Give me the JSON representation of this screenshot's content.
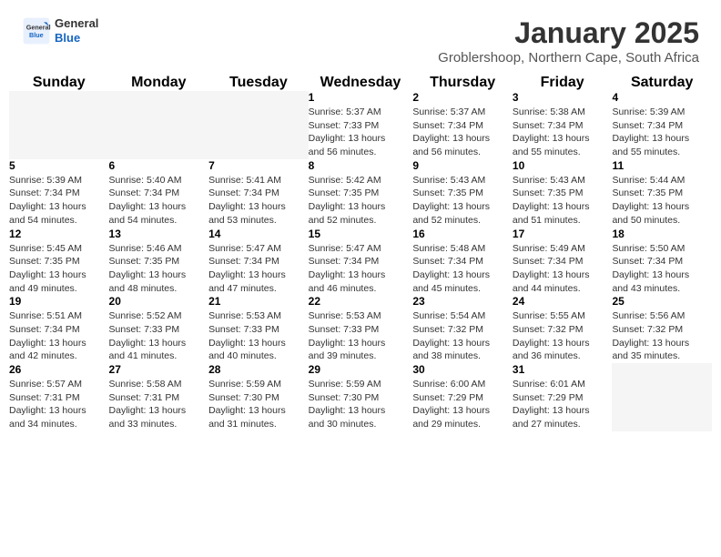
{
  "header": {
    "logo": {
      "general": "General",
      "blue": "Blue"
    },
    "title": "January 2025",
    "location": "Groblershoop, Northern Cape, South Africa"
  },
  "calendar": {
    "weekdays": [
      "Sunday",
      "Monday",
      "Tuesday",
      "Wednesday",
      "Thursday",
      "Friday",
      "Saturday"
    ],
    "weeks": [
      [
        {
          "day": "",
          "info": ""
        },
        {
          "day": "",
          "info": ""
        },
        {
          "day": "",
          "info": ""
        },
        {
          "day": "1",
          "info": "Sunrise: 5:37 AM\nSunset: 7:33 PM\nDaylight: 13 hours\nand 56 minutes."
        },
        {
          "day": "2",
          "info": "Sunrise: 5:37 AM\nSunset: 7:34 PM\nDaylight: 13 hours\nand 56 minutes."
        },
        {
          "day": "3",
          "info": "Sunrise: 5:38 AM\nSunset: 7:34 PM\nDaylight: 13 hours\nand 55 minutes."
        },
        {
          "day": "4",
          "info": "Sunrise: 5:39 AM\nSunset: 7:34 PM\nDaylight: 13 hours\nand 55 minutes."
        }
      ],
      [
        {
          "day": "5",
          "info": "Sunrise: 5:39 AM\nSunset: 7:34 PM\nDaylight: 13 hours\nand 54 minutes."
        },
        {
          "day": "6",
          "info": "Sunrise: 5:40 AM\nSunset: 7:34 PM\nDaylight: 13 hours\nand 54 minutes."
        },
        {
          "day": "7",
          "info": "Sunrise: 5:41 AM\nSunset: 7:34 PM\nDaylight: 13 hours\nand 53 minutes."
        },
        {
          "day": "8",
          "info": "Sunrise: 5:42 AM\nSunset: 7:35 PM\nDaylight: 13 hours\nand 52 minutes."
        },
        {
          "day": "9",
          "info": "Sunrise: 5:43 AM\nSunset: 7:35 PM\nDaylight: 13 hours\nand 52 minutes."
        },
        {
          "day": "10",
          "info": "Sunrise: 5:43 AM\nSunset: 7:35 PM\nDaylight: 13 hours\nand 51 minutes."
        },
        {
          "day": "11",
          "info": "Sunrise: 5:44 AM\nSunset: 7:35 PM\nDaylight: 13 hours\nand 50 minutes."
        }
      ],
      [
        {
          "day": "12",
          "info": "Sunrise: 5:45 AM\nSunset: 7:35 PM\nDaylight: 13 hours\nand 49 minutes."
        },
        {
          "day": "13",
          "info": "Sunrise: 5:46 AM\nSunset: 7:35 PM\nDaylight: 13 hours\nand 48 minutes."
        },
        {
          "day": "14",
          "info": "Sunrise: 5:47 AM\nSunset: 7:34 PM\nDaylight: 13 hours\nand 47 minutes."
        },
        {
          "day": "15",
          "info": "Sunrise: 5:47 AM\nSunset: 7:34 PM\nDaylight: 13 hours\nand 46 minutes."
        },
        {
          "day": "16",
          "info": "Sunrise: 5:48 AM\nSunset: 7:34 PM\nDaylight: 13 hours\nand 45 minutes."
        },
        {
          "day": "17",
          "info": "Sunrise: 5:49 AM\nSunset: 7:34 PM\nDaylight: 13 hours\nand 44 minutes."
        },
        {
          "day": "18",
          "info": "Sunrise: 5:50 AM\nSunset: 7:34 PM\nDaylight: 13 hours\nand 43 minutes."
        }
      ],
      [
        {
          "day": "19",
          "info": "Sunrise: 5:51 AM\nSunset: 7:34 PM\nDaylight: 13 hours\nand 42 minutes."
        },
        {
          "day": "20",
          "info": "Sunrise: 5:52 AM\nSunset: 7:33 PM\nDaylight: 13 hours\nand 41 minutes."
        },
        {
          "day": "21",
          "info": "Sunrise: 5:53 AM\nSunset: 7:33 PM\nDaylight: 13 hours\nand 40 minutes."
        },
        {
          "day": "22",
          "info": "Sunrise: 5:53 AM\nSunset: 7:33 PM\nDaylight: 13 hours\nand 39 minutes."
        },
        {
          "day": "23",
          "info": "Sunrise: 5:54 AM\nSunset: 7:32 PM\nDaylight: 13 hours\nand 38 minutes."
        },
        {
          "day": "24",
          "info": "Sunrise: 5:55 AM\nSunset: 7:32 PM\nDaylight: 13 hours\nand 36 minutes."
        },
        {
          "day": "25",
          "info": "Sunrise: 5:56 AM\nSunset: 7:32 PM\nDaylight: 13 hours\nand 35 minutes."
        }
      ],
      [
        {
          "day": "26",
          "info": "Sunrise: 5:57 AM\nSunset: 7:31 PM\nDaylight: 13 hours\nand 34 minutes."
        },
        {
          "day": "27",
          "info": "Sunrise: 5:58 AM\nSunset: 7:31 PM\nDaylight: 13 hours\nand 33 minutes."
        },
        {
          "day": "28",
          "info": "Sunrise: 5:59 AM\nSunset: 7:30 PM\nDaylight: 13 hours\nand 31 minutes."
        },
        {
          "day": "29",
          "info": "Sunrise: 5:59 AM\nSunset: 7:30 PM\nDaylight: 13 hours\nand 30 minutes."
        },
        {
          "day": "30",
          "info": "Sunrise: 6:00 AM\nSunset: 7:29 PM\nDaylight: 13 hours\nand 29 minutes."
        },
        {
          "day": "31",
          "info": "Sunrise: 6:01 AM\nSunset: 7:29 PM\nDaylight: 13 hours\nand 27 minutes."
        },
        {
          "day": "",
          "info": ""
        }
      ]
    ]
  }
}
